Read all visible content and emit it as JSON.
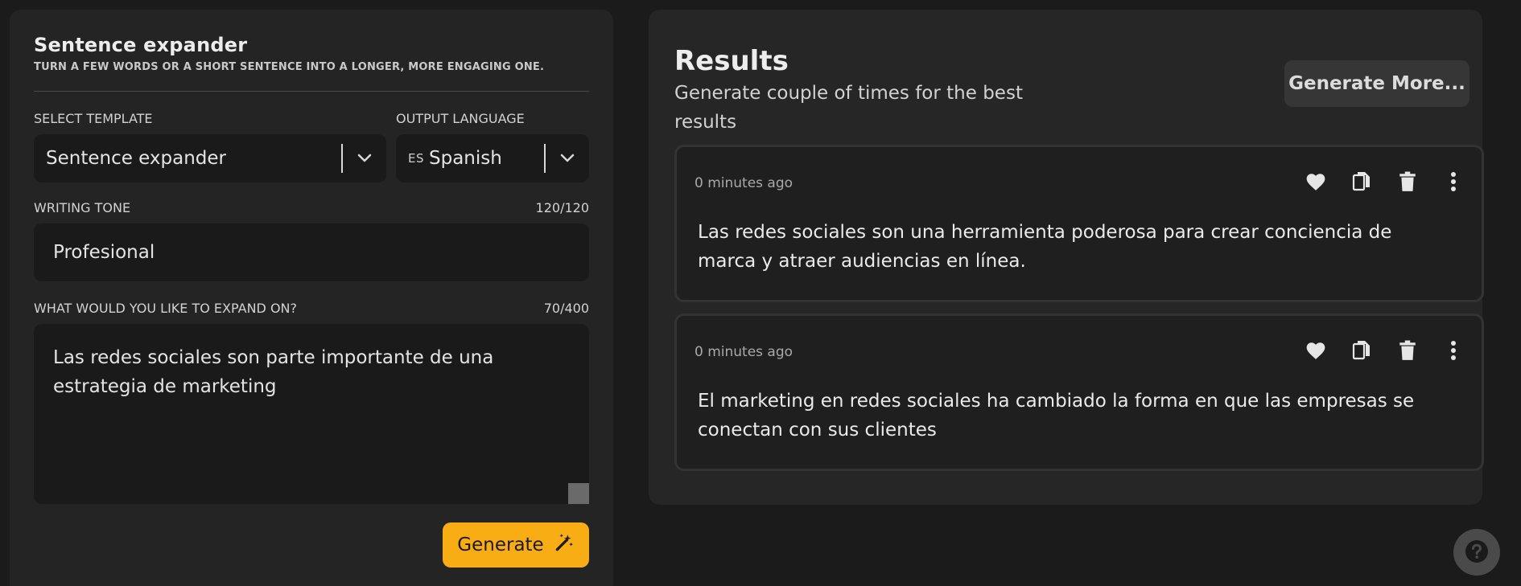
{
  "left": {
    "title": "Sentence expander",
    "subtitle": "TURN A FEW WORDS OR A SHORT SENTENCE INTO A LONGER, MORE ENGAGING ONE.",
    "template_label": "SELECT TEMPLATE",
    "template_value": "Sentence expander",
    "language_label": "OUTPUT LANGUAGE",
    "language_code": "ES",
    "language_value": "Spanish",
    "tone_label": "WRITING TONE",
    "tone_count": "120/120",
    "tone_value": "Profesional",
    "expand_label": "WHAT WOULD YOU LIKE TO EXPAND ON?",
    "expand_count": "70/400",
    "expand_value": "Las redes sociales son parte importante de una estrategia de marketing",
    "generate_label": "Generate"
  },
  "right": {
    "title": "Results",
    "subtitle": "Generate couple of times for the best results",
    "more_label": "Generate More...",
    "results": [
      {
        "time": "0 minutes ago",
        "text": "Las redes sociales son una herramienta poderosa para crear conciencia de marca y atraer audiencias en línea."
      },
      {
        "time": "0 minutes ago",
        "text": "El marketing en redes sociales ha cambiado la forma en que las empresas se conectan con sus clientes"
      }
    ]
  },
  "icons": {
    "chevron": "chevron-down-icon",
    "wand": "magic-wand-icon",
    "heart": "heart-icon",
    "copy": "copy-icon",
    "trash": "trash-icon",
    "more": "more-vertical-icon",
    "help": "help-icon"
  },
  "colors": {
    "accent": "#f9ad15",
    "background": "#1b1b1b",
    "panel": "#242424"
  }
}
